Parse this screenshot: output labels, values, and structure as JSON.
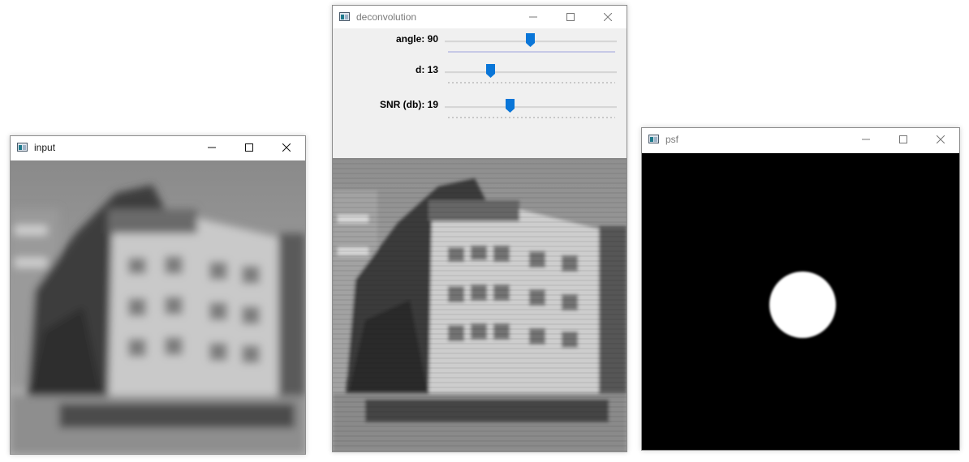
{
  "windows": {
    "input": {
      "title": "input",
      "image": "blurred-building-photo"
    },
    "deconvolution": {
      "title": "deconvolution",
      "trackbars": [
        {
          "label": "angle: 90",
          "value": 90,
          "max": 180
        },
        {
          "label": "d: 13",
          "value": 13,
          "max": 50
        },
        {
          "label": "SNR (db): 19",
          "value": 19,
          "max": 50
        }
      ],
      "image": "deconvolved-building-photo"
    },
    "psf": {
      "title": "psf",
      "image": "white-disk-on-black"
    }
  },
  "icons": {
    "app": "app-window-icon",
    "minimize": "minimize-icon",
    "maximize": "maximize-icon",
    "close": "close-icon"
  },
  "colors": {
    "thumb": "#0a76d8",
    "psf_background": "#000000",
    "psf_disk": "#ffffff"
  }
}
